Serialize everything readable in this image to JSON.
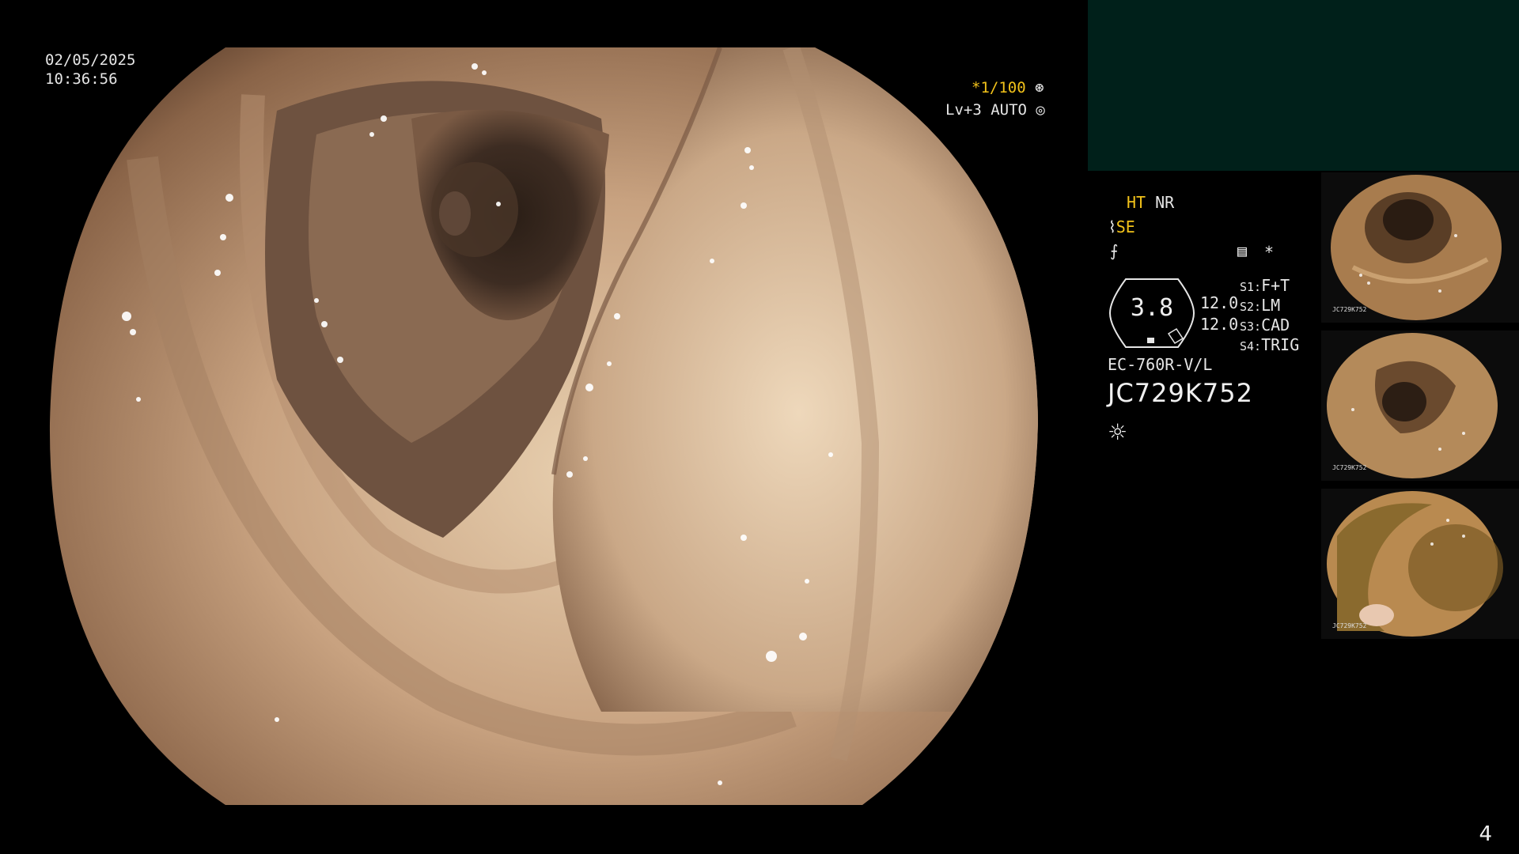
{
  "datetime": {
    "date": "02/05/2025",
    "time": "10:36:56"
  },
  "overlay": {
    "shutter": "*1/100",
    "shutter_icon": "aperture-icon",
    "level": "Lv+3 AUTO",
    "level_icon": "target-icon"
  },
  "status": {
    "ht": "HT",
    "nr": "NR",
    "se": "SE",
    "enhance_icon": "se-enhance-icon",
    "mode_icon": "f-mode-icon",
    "menu_icon": "memo-icon",
    "star": "*"
  },
  "zoom": {
    "value": "3.8",
    "line1": "12.0",
    "line2": "12.0"
  },
  "switches": [
    {
      "key": "S1:",
      "value": "F+T"
    },
    {
      "key": "S2:",
      "value": "LM"
    },
    {
      "key": "S3:",
      "value": "CAD"
    },
    {
      "key": "S4:",
      "value": "TRIG"
    }
  ],
  "scope": {
    "model": "EC-760R-V/L",
    "serial": "JC729K752"
  },
  "light_icon": "sun-icon",
  "thumbnails": [
    {
      "label": "JC729K752"
    },
    {
      "label": "JC729K752"
    },
    {
      "label": "JC729K752"
    }
  ],
  "page_number": "4",
  "colors": {
    "accent_yellow": "#f2c21a",
    "panel_teal": "#00201a",
    "tissue": "#c9a88a"
  }
}
